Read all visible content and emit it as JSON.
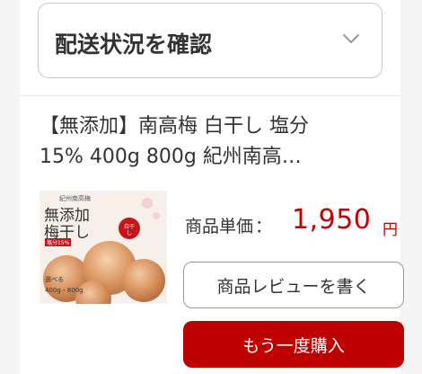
{
  "shipping": {
    "label": "配送状況を確認",
    "icon": "chevron-down-icon"
  },
  "product": {
    "title_line1": "【無添加】南高梅 白干し 塩分",
    "title_line2": "15% 400g 800g 紀州南高…",
    "image_text": {
      "small": "紀州南高梅",
      "main_line1": "無添加",
      "main_line2": "梅干し",
      "badge": "塩分15%",
      "seal": "白干し",
      "choose": "選べる",
      "weights": "400g・800g"
    },
    "price_label": "商品単価",
    "price_colon": "：",
    "price_value": "1,950",
    "price_unit": "円"
  },
  "actions": {
    "review_label": "商品レビューを書く",
    "rebuy_label": "もう一度購入"
  },
  "colors": {
    "accent": "#bf0000",
    "text": "#333333",
    "border": "#c9c9c9"
  }
}
